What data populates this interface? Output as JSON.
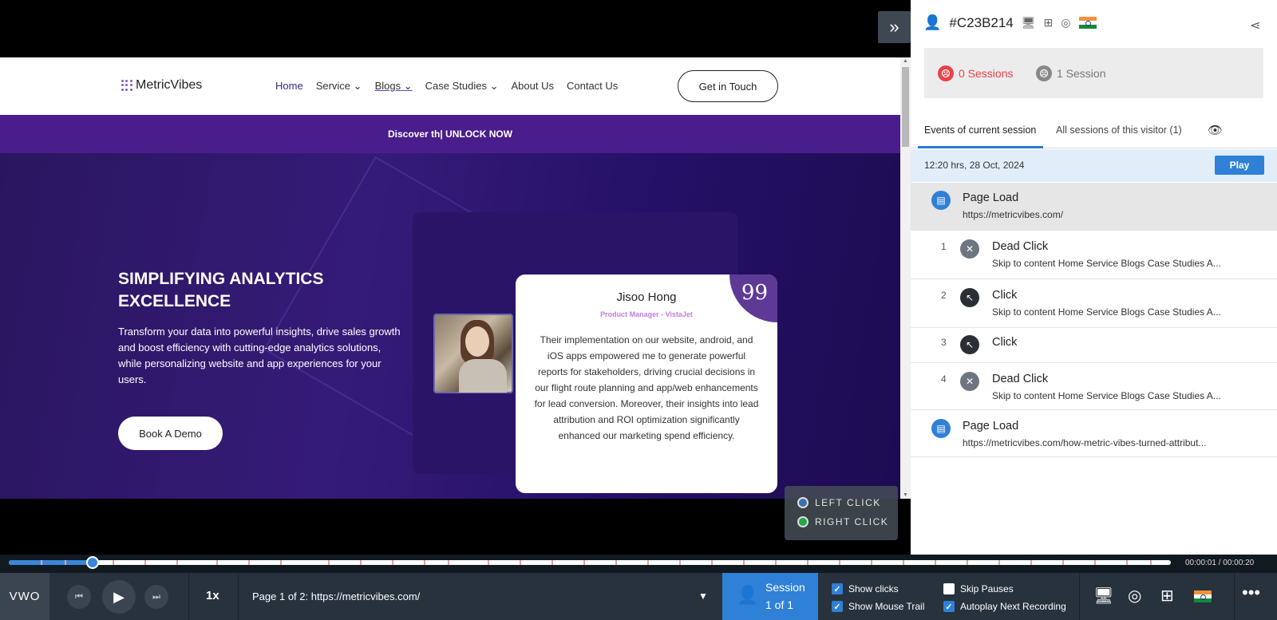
{
  "visitor": {
    "id": "#C23B214",
    "sessions_0": "0 Sessions",
    "sessions_1": "1 Session"
  },
  "tabs": {
    "current": "Events of current session",
    "all": "All sessions of this visitor (1)"
  },
  "session_bar": {
    "datetime": "12:20 hrs, 28 Oct, 2024",
    "play": "Play"
  },
  "events": [
    {
      "num": "",
      "type": "Page Load",
      "sub": "https://metricvibes.com/",
      "icon": "page-icon"
    },
    {
      "num": "1",
      "type": "Dead Click",
      "sub": "Skip to content Home Service Blogs Case Studies A...",
      "icon": "dead-face-icon"
    },
    {
      "num": "2",
      "type": "Click",
      "sub": "Skip to content Home Service Blogs Case Studies A...",
      "icon": "cursor-click-icon"
    },
    {
      "num": "3",
      "type": "Click",
      "sub": "",
      "icon": "cursor-click-icon"
    },
    {
      "num": "4",
      "type": "Dead Click",
      "sub": "Skip to content Home Service Blogs Case Studies A...",
      "icon": "dead-face-icon"
    },
    {
      "num": "",
      "type": "Page Load",
      "sub": "https://metricvibes.com/how-metric-vibes-turned-attribut...",
      "icon": "page-icon"
    }
  ],
  "site": {
    "logo": "MetricVibes",
    "nav": [
      "Home",
      "Service",
      "Blogs",
      "Case Studies",
      "About Us",
      "Contact Us"
    ],
    "cta": "Get in Touch",
    "banner_prefix": "Discover th|",
    "banner_link": "UNLOCK NOW",
    "hero_title": "SIMPLIFYING ANALYTICS EXCELLENCE",
    "hero_desc": "Transform your data into powerful insights, drive sales growth and boost efficiency with cutting-edge  analytics solutions, while personalizing website and app experiences for your users.",
    "demo_btn": "Book A Demo",
    "testimonial": {
      "name": "Jisoo Hong",
      "role": "Product Manager - VistaJet",
      "quote_mark": "99",
      "text": "Their implementation on our website, android, and iOS apps empowered me to generate powerful reports for stakeholders, driving crucial decisions in our flight route planning and app/web enhancements for lead conversion. Moreover, their insights into lead attribution and ROI optimization significantly enhanced our marketing spend efficiency."
    }
  },
  "legend": {
    "left": "LEFT CLICK",
    "right": "RIGHT CLICK",
    "left_color": "#3b6fb0",
    "right_color": "#1ea84a"
  },
  "timeline": {
    "time": "00:00:01 / 00:00:20",
    "progress": 0.05
  },
  "controls": {
    "brand": "VWO",
    "speed": "1x",
    "page": "Page 1 of 2: https://metricvibes.com/",
    "session_label": "Session",
    "session_count": "1 of 1",
    "show_clicks": "Show clicks",
    "show_mouse_trail": "Show Mouse Trail",
    "skip_pauses": "Skip Pauses",
    "autoplay": "Autoplay Next Recording"
  },
  "colors": {
    "accent": "#2f80d7",
    "dead_session": "#e8424a",
    "hero_purple": "#351b78"
  }
}
